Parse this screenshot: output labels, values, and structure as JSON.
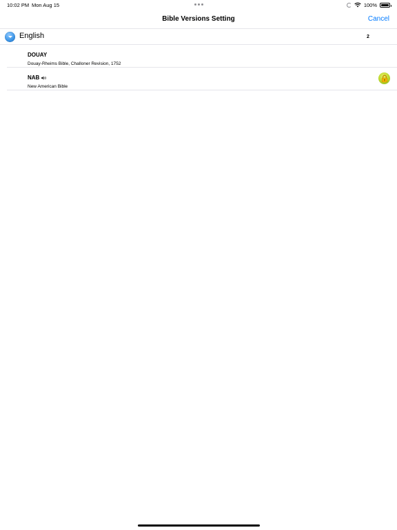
{
  "status_bar": {
    "time": "10:02 PM",
    "date": "Mon Aug 15",
    "battery": "100%"
  },
  "nav": {
    "title": "Bible Versions Setting",
    "cancel_label": "Cancel"
  },
  "section": {
    "title": "English",
    "count": "2",
    "icon": "chevron-down-circle-icon"
  },
  "versions": [
    {
      "code": "DOUAY",
      "name": "Douay-Rheims Bible, Challoner Revision, 1752",
      "has_audio": false,
      "locked": false
    },
    {
      "code": "NAB",
      "name": "New American Bible",
      "has_audio": true,
      "locked": true
    }
  ],
  "colors": {
    "accent": "#007aff",
    "section_icon": "#3c94e6",
    "lock_badge": "#b9d62a",
    "lock_body": "#f2b705"
  }
}
